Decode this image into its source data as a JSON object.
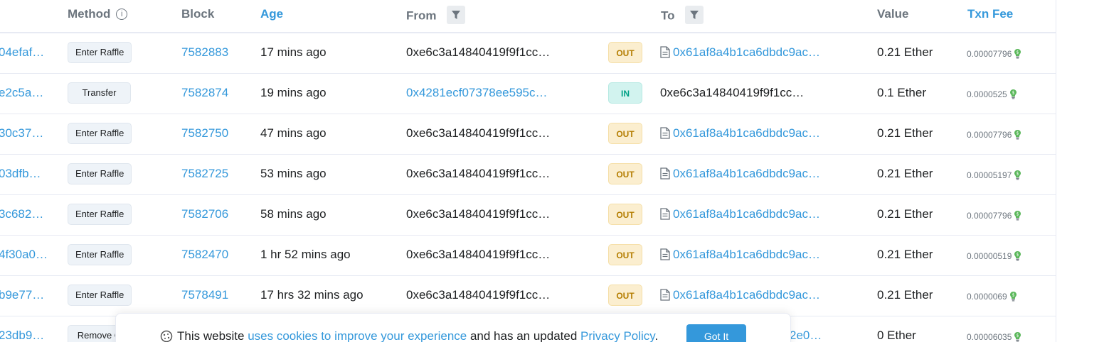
{
  "header": {
    "method": "Method",
    "info_glyph": "i",
    "block": "Block",
    "age": "Age",
    "from": "From",
    "to": "To",
    "value": "Value",
    "txn_fee": "Txn Fee"
  },
  "rows": [
    {
      "hash": "04efaf…",
      "method": "Enter Raffle",
      "block": "7582883",
      "age": "17 mins ago",
      "from": "0xe6c3a14840419f9f1cc…",
      "dir": "OUT",
      "to": "0x61af8a4b1ca6dbdc9ac…",
      "value": "0.21 Ether",
      "fee": "0.00007796"
    },
    {
      "hash": "e2c5a…",
      "method": "Transfer",
      "block": "7582874",
      "age": "19 mins ago",
      "from": "0x4281ecf07378ee595c…",
      "dir": "IN",
      "to": "0xe6c3a14840419f9f1cc…",
      "value": "0.1 Ether",
      "fee": "0.0000525"
    },
    {
      "hash": "30c37…",
      "method": "Enter Raffle",
      "block": "7582750",
      "age": "47 mins ago",
      "from": "0xe6c3a14840419f9f1cc…",
      "dir": "OUT",
      "to": "0x61af8a4b1ca6dbdc9ac…",
      "value": "0.21 Ether",
      "fee": "0.00007796"
    },
    {
      "hash": "03dfb…",
      "method": "Enter Raffle",
      "block": "7582725",
      "age": "53 mins ago",
      "from": "0xe6c3a14840419f9f1cc…",
      "dir": "OUT",
      "to": "0x61af8a4b1ca6dbdc9ac…",
      "value": "0.21 Ether",
      "fee": "0.00005197"
    },
    {
      "hash": "3c682…",
      "method": "Enter Raffle",
      "block": "7582706",
      "age": "58 mins ago",
      "from": "0xe6c3a14840419f9f1cc…",
      "dir": "OUT",
      "to": "0x61af8a4b1ca6dbdc9ac…",
      "value": "0.21 Ether",
      "fee": "0.00007796"
    },
    {
      "hash": "4f30a0…",
      "method": "Enter Raffle",
      "block": "7582470",
      "age": "1 hr 52 mins ago",
      "from": "0xe6c3a14840419f9f1cc…",
      "dir": "OUT",
      "to": "0x61af8a4b1ca6dbdc9ac…",
      "value": "0.21 Ether",
      "fee": "0.00000519"
    },
    {
      "hash": "b9e77…",
      "method": "Enter Raffle",
      "block": "7578491",
      "age": "17 hrs 32 mins ago",
      "from": "0xe6c3a14840419f9f1cc…",
      "dir": "OUT",
      "to": "0x61af8a4b1ca6dbdc9ac…",
      "value": "0.21 Ether",
      "fee": "0.0000069"
    },
    {
      "hash": "23db9…",
      "method": "Remove C",
      "block": "",
      "age": "",
      "from": "",
      "dir": "",
      "to": "2e0…",
      "value": "0 Ether",
      "fee": "0.00006035"
    }
  ],
  "cookie": {
    "text_1": "This website ",
    "link_1": "uses cookies to improve your experience",
    "text_2": " and has an updated ",
    "link_2": "Privacy Policy",
    "text_3": ".",
    "button": "Got It"
  },
  "colors": {
    "link": "#3498db",
    "out_badge": "#fbeecf",
    "in_badge": "#d2f3ef",
    "button": "#3498db"
  },
  "icons": [
    "info-icon",
    "filter-icon",
    "document-icon",
    "gas-bulb-icon",
    "cookie-icon"
  ]
}
